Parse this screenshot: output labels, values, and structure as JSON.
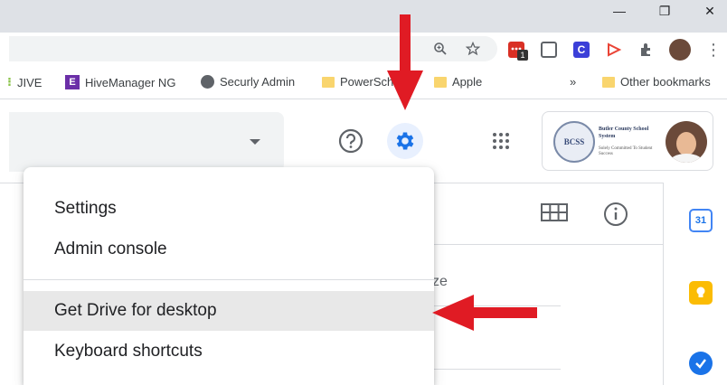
{
  "window": {
    "minimize_glyph": "—",
    "restore_glyph": "❐",
    "close_glyph": "✕"
  },
  "omnibox": {
    "zoom_icon": "zoom-icon",
    "star_icon": "star-icon"
  },
  "extensions": {
    "badge_count": "1",
    "menu_glyph": "⋮"
  },
  "bookmarks": {
    "items": [
      {
        "label": "JIVE",
        "icon": "jive-icon"
      },
      {
        "label": "HiveManager NG",
        "icon": "extreme-icon"
      },
      {
        "label": "Securly Admin",
        "icon": "globe-icon"
      },
      {
        "label": "PowerSch",
        "icon": "folder-icon"
      },
      {
        "label": "Apple",
        "icon": "folder-icon"
      }
    ],
    "overflow": "»",
    "other": "Other bookmarks"
  },
  "account": {
    "seal_text": "BCSS",
    "school_name": "Butler County School System",
    "school_tagline": "Solely Committed To Student Success"
  },
  "content": {
    "column_fragment": "ze"
  },
  "calendar_day": "31",
  "menu": {
    "items": [
      "Settings",
      "Admin console",
      "Get Drive for desktop",
      "Keyboard shortcuts"
    ],
    "highlighted_index": 2
  },
  "colors": {
    "arrow": "#e01b24",
    "accent": "#1a73e8"
  }
}
